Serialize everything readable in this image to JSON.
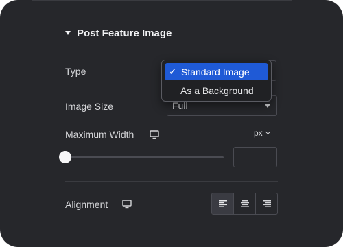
{
  "section": {
    "title": "Post Feature Image"
  },
  "type_field": {
    "label": "Type",
    "options": [
      "Standard Image",
      "As a Background"
    ],
    "selected_index": 0,
    "check_glyph": "✓"
  },
  "image_size_field": {
    "label": "Image Size",
    "value": "Full"
  },
  "max_width_field": {
    "label": "Maximum Width",
    "unit": "px",
    "slider_value_fraction": 0,
    "input_value": ""
  },
  "alignment_field": {
    "label": "Alignment",
    "options": [
      "align-left-icon",
      "align-center-icon",
      "align-right-icon"
    ],
    "selected_index": 0
  },
  "colors": {
    "panel_bg": "#26272b",
    "accent_selected": "#1f5ad6",
    "text": "#d5d6d9"
  }
}
